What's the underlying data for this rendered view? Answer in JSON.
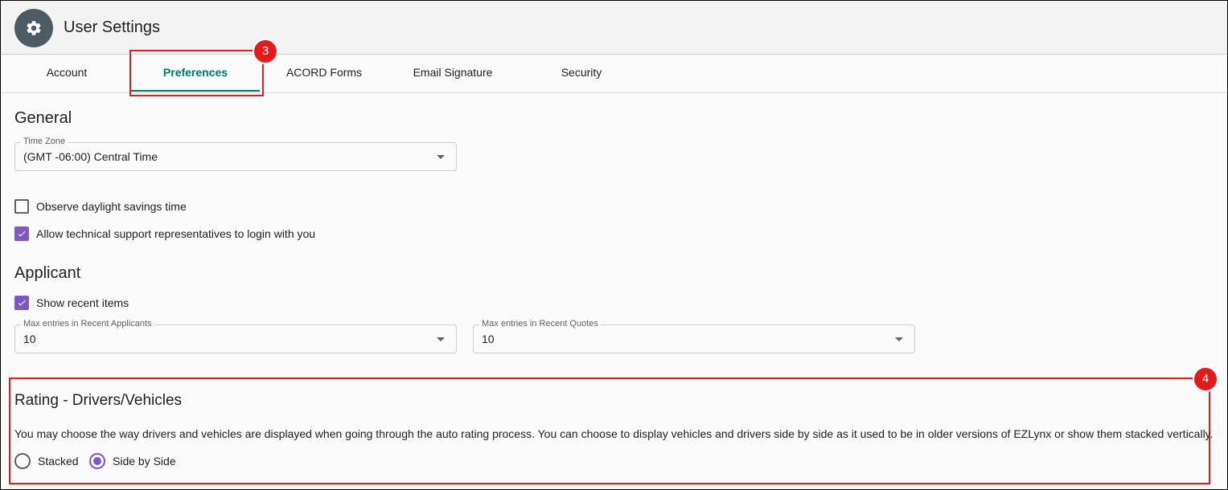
{
  "header": {
    "title": "User Settings",
    "icon": "gear-icon"
  },
  "tabs": [
    {
      "label": "Account",
      "active": false
    },
    {
      "label": "Preferences",
      "active": true
    },
    {
      "label": "ACORD Forms",
      "active": false
    },
    {
      "label": "Email Signature",
      "active": false
    },
    {
      "label": "Security",
      "active": false
    }
  ],
  "callouts": {
    "tab_number": "3",
    "rating_number": "4",
    "color": "#e31b1b"
  },
  "accent_color": "#00796b",
  "control_color": "#7e57c2",
  "general": {
    "heading": "General",
    "time_zone": {
      "label": "Time Zone",
      "value": "(GMT -06:00) Central Time"
    },
    "observe_dst": {
      "label": "Observe daylight savings time",
      "checked": false
    },
    "allow_support": {
      "label": "Allow technical support representatives to login with you",
      "checked": true
    }
  },
  "applicant": {
    "heading": "Applicant",
    "show_recent": {
      "label": "Show recent items",
      "checked": true
    },
    "max_recent_applicants": {
      "label": "Max entries in Recent Applicants",
      "value": "10"
    },
    "max_recent_quotes": {
      "label": "Max entries in Recent Quotes",
      "value": "10"
    }
  },
  "rating": {
    "heading": "Rating - Drivers/Vehicles",
    "description": "You may choose the way drivers and vehicles are displayed when going through the auto rating process. You can choose to display vehicles and drivers side by side as it used to be in older versions of EZLynx or show them stacked vertically.",
    "options": [
      {
        "label": "Stacked",
        "selected": false
      },
      {
        "label": "Side by Side",
        "selected": true
      }
    ]
  }
}
